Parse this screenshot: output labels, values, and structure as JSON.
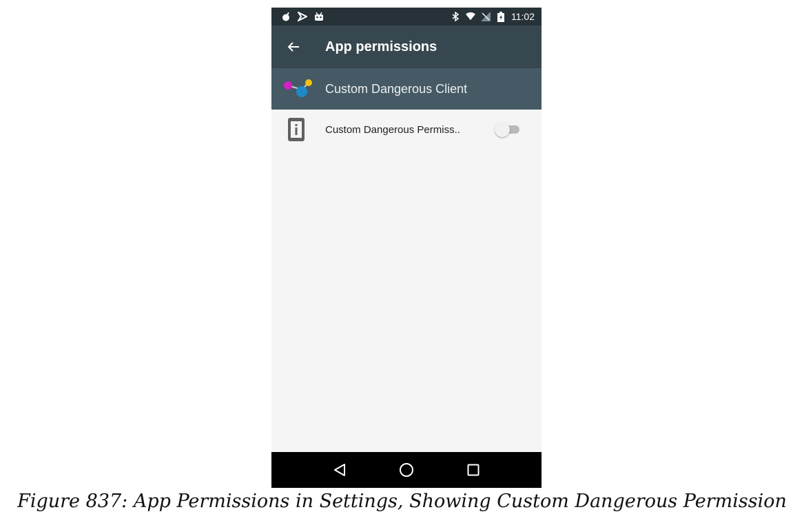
{
  "status_bar": {
    "notification_icons": [
      "bomb-icon",
      "play-store-icon",
      "android-icon"
    ],
    "system_icons": [
      "bluetooth-icon",
      "wifi-icon",
      "signal-icon",
      "battery-charging-icon"
    ],
    "time": "11:02"
  },
  "toolbar": {
    "back_icon": "arrow-back-icon",
    "title": "App permissions"
  },
  "app_header": {
    "app_icon": "molecule-app-icon",
    "app_name": "Custom Dangerous Client"
  },
  "permissions": [
    {
      "icon": "info-device-icon",
      "label": "Custom Dangerous Permiss..",
      "enabled": false
    }
  ],
  "nav_bar": {
    "buttons": [
      "back-triangle-icon",
      "home-circle-icon",
      "recents-square-icon"
    ]
  },
  "caption": "Figure 837: App Permissions in Settings, Showing Custom Dangerous Permission",
  "colors": {
    "status_bar": "#263238",
    "toolbar": "#37474f",
    "app_header": "#455a64",
    "background": "#f5f5f5"
  }
}
